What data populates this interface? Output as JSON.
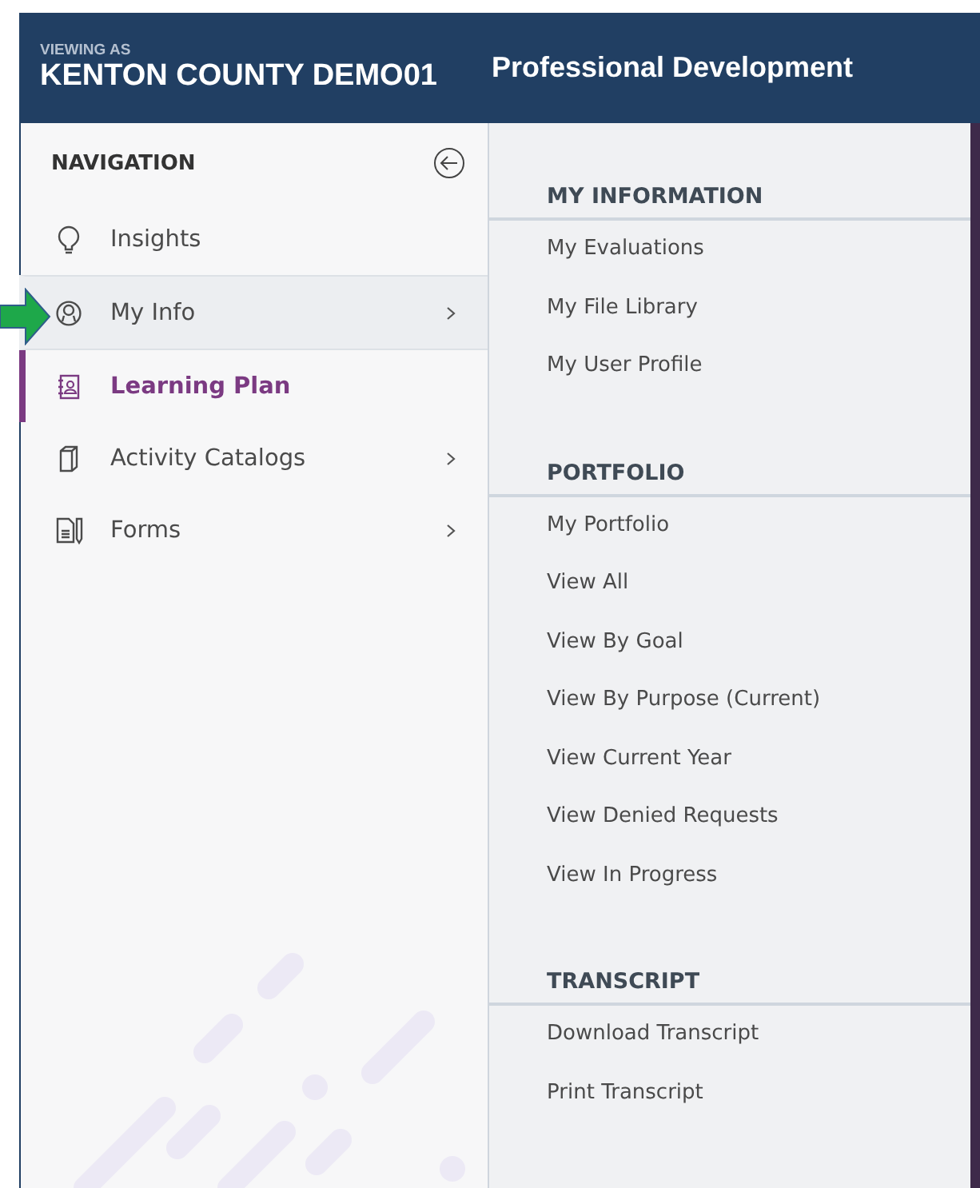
{
  "header": {
    "viewing_as_label": "VIEWING AS",
    "account": "KENTON COUNTY DEMO01",
    "title": "Professional Development"
  },
  "navigation": {
    "title": "NAVIGATION",
    "items": [
      {
        "label": "Insights",
        "kind": "bulb",
        "has_submenu": false,
        "selected": false,
        "expanded": false
      },
      {
        "label": "My Info",
        "kind": "person",
        "has_submenu": true,
        "selected": false,
        "expanded": true
      },
      {
        "label": "Learning Plan",
        "kind": "plan",
        "has_submenu": false,
        "selected": true,
        "expanded": false
      },
      {
        "label": "Activity Catalogs",
        "kind": "book",
        "has_submenu": true,
        "selected": false,
        "expanded": false
      },
      {
        "label": "Forms",
        "kind": "form",
        "has_submenu": true,
        "selected": false,
        "expanded": false
      }
    ]
  },
  "submenu": {
    "sections": [
      {
        "title": "MY INFORMATION",
        "items": [
          "My Evaluations",
          "My File Library",
          "My User Profile"
        ]
      },
      {
        "title": "PORTFOLIO",
        "items": [
          "My Portfolio",
          "View All",
          "View By Goal",
          "View By Purpose (Current)",
          "View Current Year",
          "View Denied Requests",
          "View In Progress"
        ]
      },
      {
        "title": "TRANSCRIPT",
        "items": [
          "Download Transcript",
          "Print Transcript"
        ]
      }
    ]
  }
}
